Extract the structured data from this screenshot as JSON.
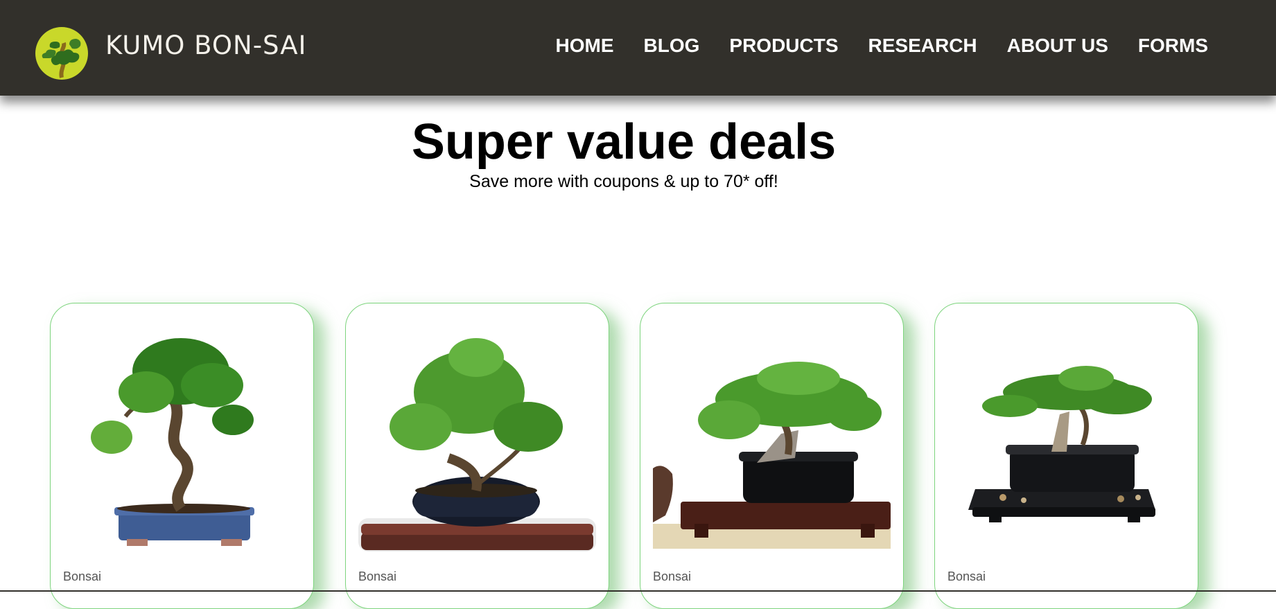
{
  "brand": {
    "name": "KUMO BON-SAI",
    "logo_icon": "bonsai-logo-icon"
  },
  "nav": {
    "items": [
      "HOME",
      "BLOG",
      "PRODUCTS",
      "RESEARCH",
      "ABOUT US",
      "FORMS"
    ]
  },
  "hero": {
    "title": "Super value deals",
    "subtitle": "Save more with coupons & up to 70* off!"
  },
  "products": [
    {
      "category": "Bonsai",
      "image_icon": "bonsai-ficus-image"
    },
    {
      "category": "Bonsai",
      "image_icon": "bonsai-elm-image"
    },
    {
      "category": "Bonsai",
      "image_icon": "bonsai-juniper-image"
    },
    {
      "category": "Bonsai",
      "image_icon": "bonsai-juniper-tray-image"
    }
  ],
  "colors": {
    "header_bg": "#32302b",
    "accent_green": "#7dd47d",
    "logo_yellow": "#c9d82a"
  }
}
